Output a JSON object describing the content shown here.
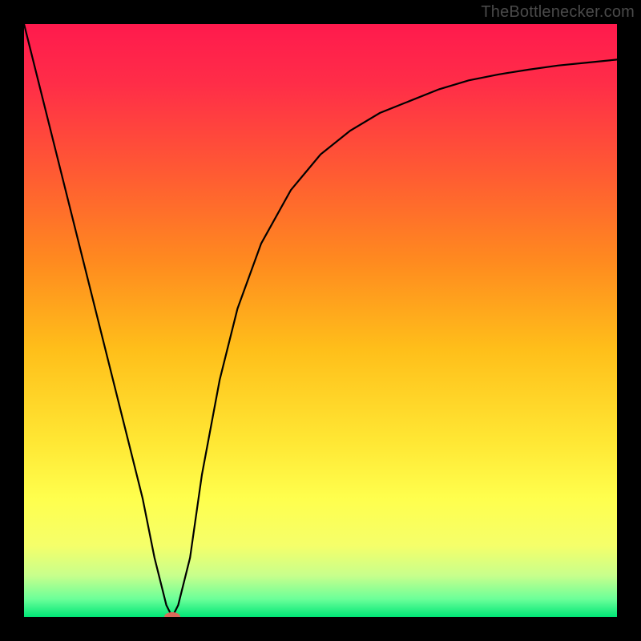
{
  "watermark": "TheBottlenecker.com",
  "colors": {
    "frame": "#000000",
    "gradient_stops": [
      {
        "offset": 0.0,
        "color": "#ff1a4d"
      },
      {
        "offset": 0.1,
        "color": "#ff2d48"
      },
      {
        "offset": 0.25,
        "color": "#ff5a33"
      },
      {
        "offset": 0.4,
        "color": "#ff8a1f"
      },
      {
        "offset": 0.55,
        "color": "#ffbf1a"
      },
      {
        "offset": 0.7,
        "color": "#ffe633"
      },
      {
        "offset": 0.8,
        "color": "#ffff4d"
      },
      {
        "offset": 0.88,
        "color": "#f5ff6a"
      },
      {
        "offset": 0.93,
        "color": "#c8ff8c"
      },
      {
        "offset": 0.97,
        "color": "#6bff99"
      },
      {
        "offset": 1.0,
        "color": "#00e676"
      }
    ],
    "curve": "#000000",
    "marker": "#d96a5a"
  },
  "chart_data": {
    "type": "line",
    "title": "",
    "xlabel": "",
    "ylabel": "",
    "xlim": [
      0,
      100
    ],
    "ylim": [
      0,
      100
    ],
    "series": [
      {
        "name": "bottleneck-curve",
        "x": [
          0,
          5,
          10,
          15,
          20,
          22,
          24,
          25,
          26,
          28,
          30,
          33,
          36,
          40,
          45,
          50,
          55,
          60,
          65,
          70,
          75,
          80,
          85,
          90,
          95,
          100
        ],
        "y": [
          100,
          80,
          60,
          40,
          20,
          10,
          2,
          0,
          2,
          10,
          24,
          40,
          52,
          63,
          72,
          78,
          82,
          85,
          87,
          89,
          90.5,
          91.5,
          92.3,
          93,
          93.5,
          94
        ]
      }
    ],
    "marker": {
      "x": 25,
      "y": 0,
      "name": "optimal-point"
    }
  }
}
